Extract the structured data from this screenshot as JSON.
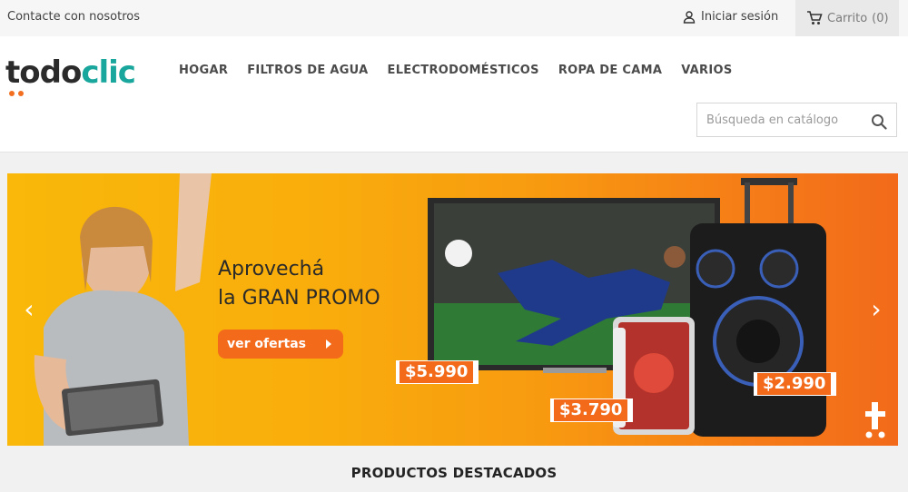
{
  "topbar": {
    "contact_label": "Contacte con nosotros",
    "login_label": "Iniciar sesión",
    "cart_label": "Carrito",
    "cart_count": "(0)"
  },
  "brand": {
    "logo_part1": "todo",
    "logo_part2": "clic",
    "accent_color": "#19a69c",
    "orange_color": "#f26a1a"
  },
  "nav": {
    "items": [
      {
        "label": "HOGAR"
      },
      {
        "label": "FILTROS DE AGUA"
      },
      {
        "label": "ELECTRODOMÉSTICOS"
      },
      {
        "label": "ROPA DE CAMA"
      },
      {
        "label": "VARIOS"
      }
    ]
  },
  "search": {
    "placeholder": "Búsqueda en catálogo",
    "value": ""
  },
  "banner": {
    "headline_line1": "Aprovechá",
    "headline_line2": "la GRAN PROMO",
    "cta_label": "ver ofertas",
    "prices": [
      {
        "value": "$5.990"
      },
      {
        "value": "$3.790"
      },
      {
        "value": "$2.990"
      }
    ],
    "arrow_left": "‹",
    "arrow_right": "›"
  },
  "section": {
    "title": "PRODUCTOS DESTACADOS"
  }
}
